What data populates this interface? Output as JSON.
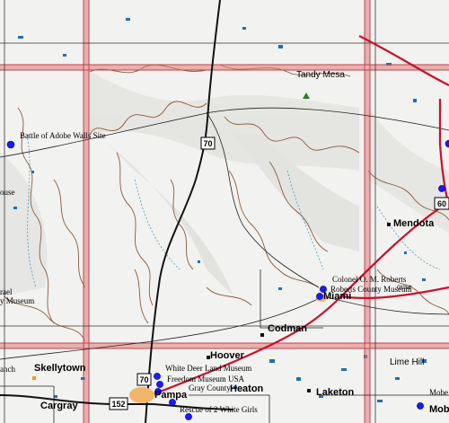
{
  "map": {
    "towns": {
      "skellytown": "Skellytown",
      "cargray": "Cargray",
      "hoover": "Hoover",
      "codman": "Codman",
      "heaton": "Heaton",
      "laketon": "Laketon",
      "mendota": "Mendota",
      "miami": "Miami",
      "pampa": "Pampa",
      "mobeetie": "Mobeetie"
    },
    "peaks": {
      "tandy_mesa": "Tandy Mesa",
      "lime_hill": "Lime Hill"
    },
    "pois": {
      "adobe_walls": "Battle of Adobe Walls Site",
      "colonel": "Colonel O. M. Roberts",
      "roberts_museum": "Roberts County Museum",
      "white_deer": "White Deer Land Museum",
      "freedom": "Freedom Museum USA",
      "gray_county": "Gray County",
      "rescue": "Rescue of 2 White Girls",
      "left_house": "ouse",
      "left_museum": "y Museum",
      "left_rael": "rael",
      "left_ranch": "anch",
      "right_house": "ouse",
      "right_mobe": "Mobe"
    },
    "shields": {
      "us70_north": "70",
      "us70_south": "70",
      "us60": "60",
      "us152": "152"
    },
    "colors": {
      "grid": "#e07a7a",
      "highway": "#c8102e",
      "road": "#111111",
      "contour": "#8b5a3c",
      "water": "#1f6fb5",
      "marker": "#1a1aff"
    }
  }
}
